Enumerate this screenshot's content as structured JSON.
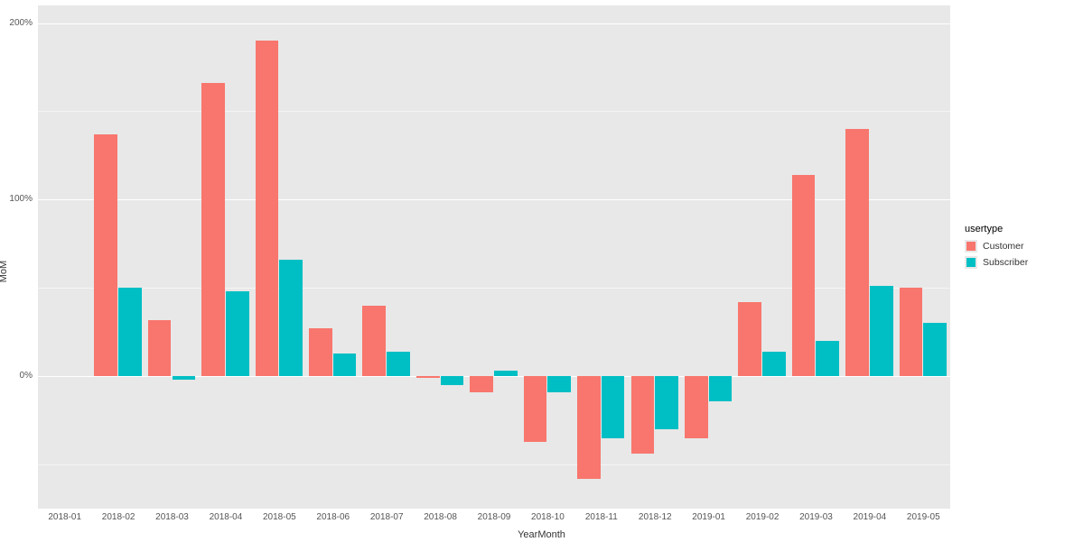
{
  "chart_data": {
    "type": "bar",
    "title": "",
    "xlabel": "YearMonth",
    "ylabel": "MoM",
    "ylim": [
      -75,
      210
    ],
    "y_ticks": [
      0,
      100,
      200
    ],
    "y_tick_labels": [
      "0%",
      "100%",
      "200%"
    ],
    "categories": [
      "2018-01",
      "2018-02",
      "2018-03",
      "2018-04",
      "2018-05",
      "2018-06",
      "2018-07",
      "2018-08",
      "2018-09",
      "2018-10",
      "2018-11",
      "2018-12",
      "2019-01",
      "2019-02",
      "2019-03",
      "2019-04",
      "2019-05"
    ],
    "series": [
      {
        "name": "Customer",
        "color": "#F8766D",
        "values": [
          null,
          137,
          32,
          166,
          190,
          27,
          40,
          -1,
          -9,
          -37,
          -58,
          -44,
          -35,
          42,
          114,
          140,
          50
        ]
      },
      {
        "name": "Subscriber",
        "color": "#00BFC4",
        "values": [
          null,
          50,
          -2,
          48,
          66,
          13,
          14,
          -5,
          3,
          -9,
          -35,
          -30,
          -14,
          14,
          20,
          51,
          30
        ]
      }
    ],
    "legend": {
      "title": "usertype",
      "items": [
        "Customer",
        "Subscriber"
      ],
      "position": "right"
    }
  }
}
